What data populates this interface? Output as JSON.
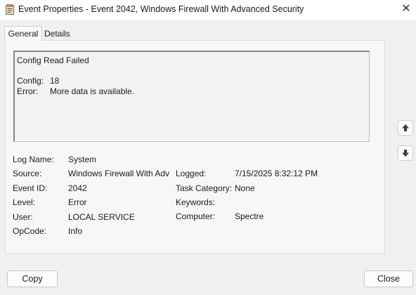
{
  "window": {
    "title": "Event Properties - Event 2042, Windows Firewall With Advanced Security",
    "close_icon": "close-icon"
  },
  "tabs": [
    {
      "label": "General",
      "selected": true
    },
    {
      "label": "Details",
      "selected": false
    }
  ],
  "description": {
    "title": "Config Read Failed",
    "config_label": "Config:",
    "config_value": "18",
    "error_label": "Error:",
    "error_value": "More data is available."
  },
  "fields": {
    "log_name": {
      "label": "Log Name:",
      "value": "System"
    },
    "source": {
      "label": "Source:",
      "value": "Windows Firewall With Advanced Security"
    },
    "event_id": {
      "label": "Event ID:",
      "value": "2042"
    },
    "level": {
      "label": "Level:",
      "value": "Error"
    },
    "user": {
      "label": "User:",
      "value": "LOCAL SERVICE"
    },
    "opcode": {
      "label": "OpCode:",
      "value": "Info"
    },
    "logged": {
      "label": "Logged:",
      "value": "7/15/2025 8:32:12 PM"
    },
    "task_category": {
      "label": "Task Category:",
      "value": "None"
    },
    "keywords": {
      "label": "Keywords:",
      "value": ""
    },
    "computer": {
      "label": "Computer:",
      "value": "Spectre"
    }
  },
  "nav": {
    "up_icon": "arrow-up-icon",
    "down_icon": "arrow-down-icon"
  },
  "buttons": {
    "copy": "Copy",
    "close": "Close"
  }
}
